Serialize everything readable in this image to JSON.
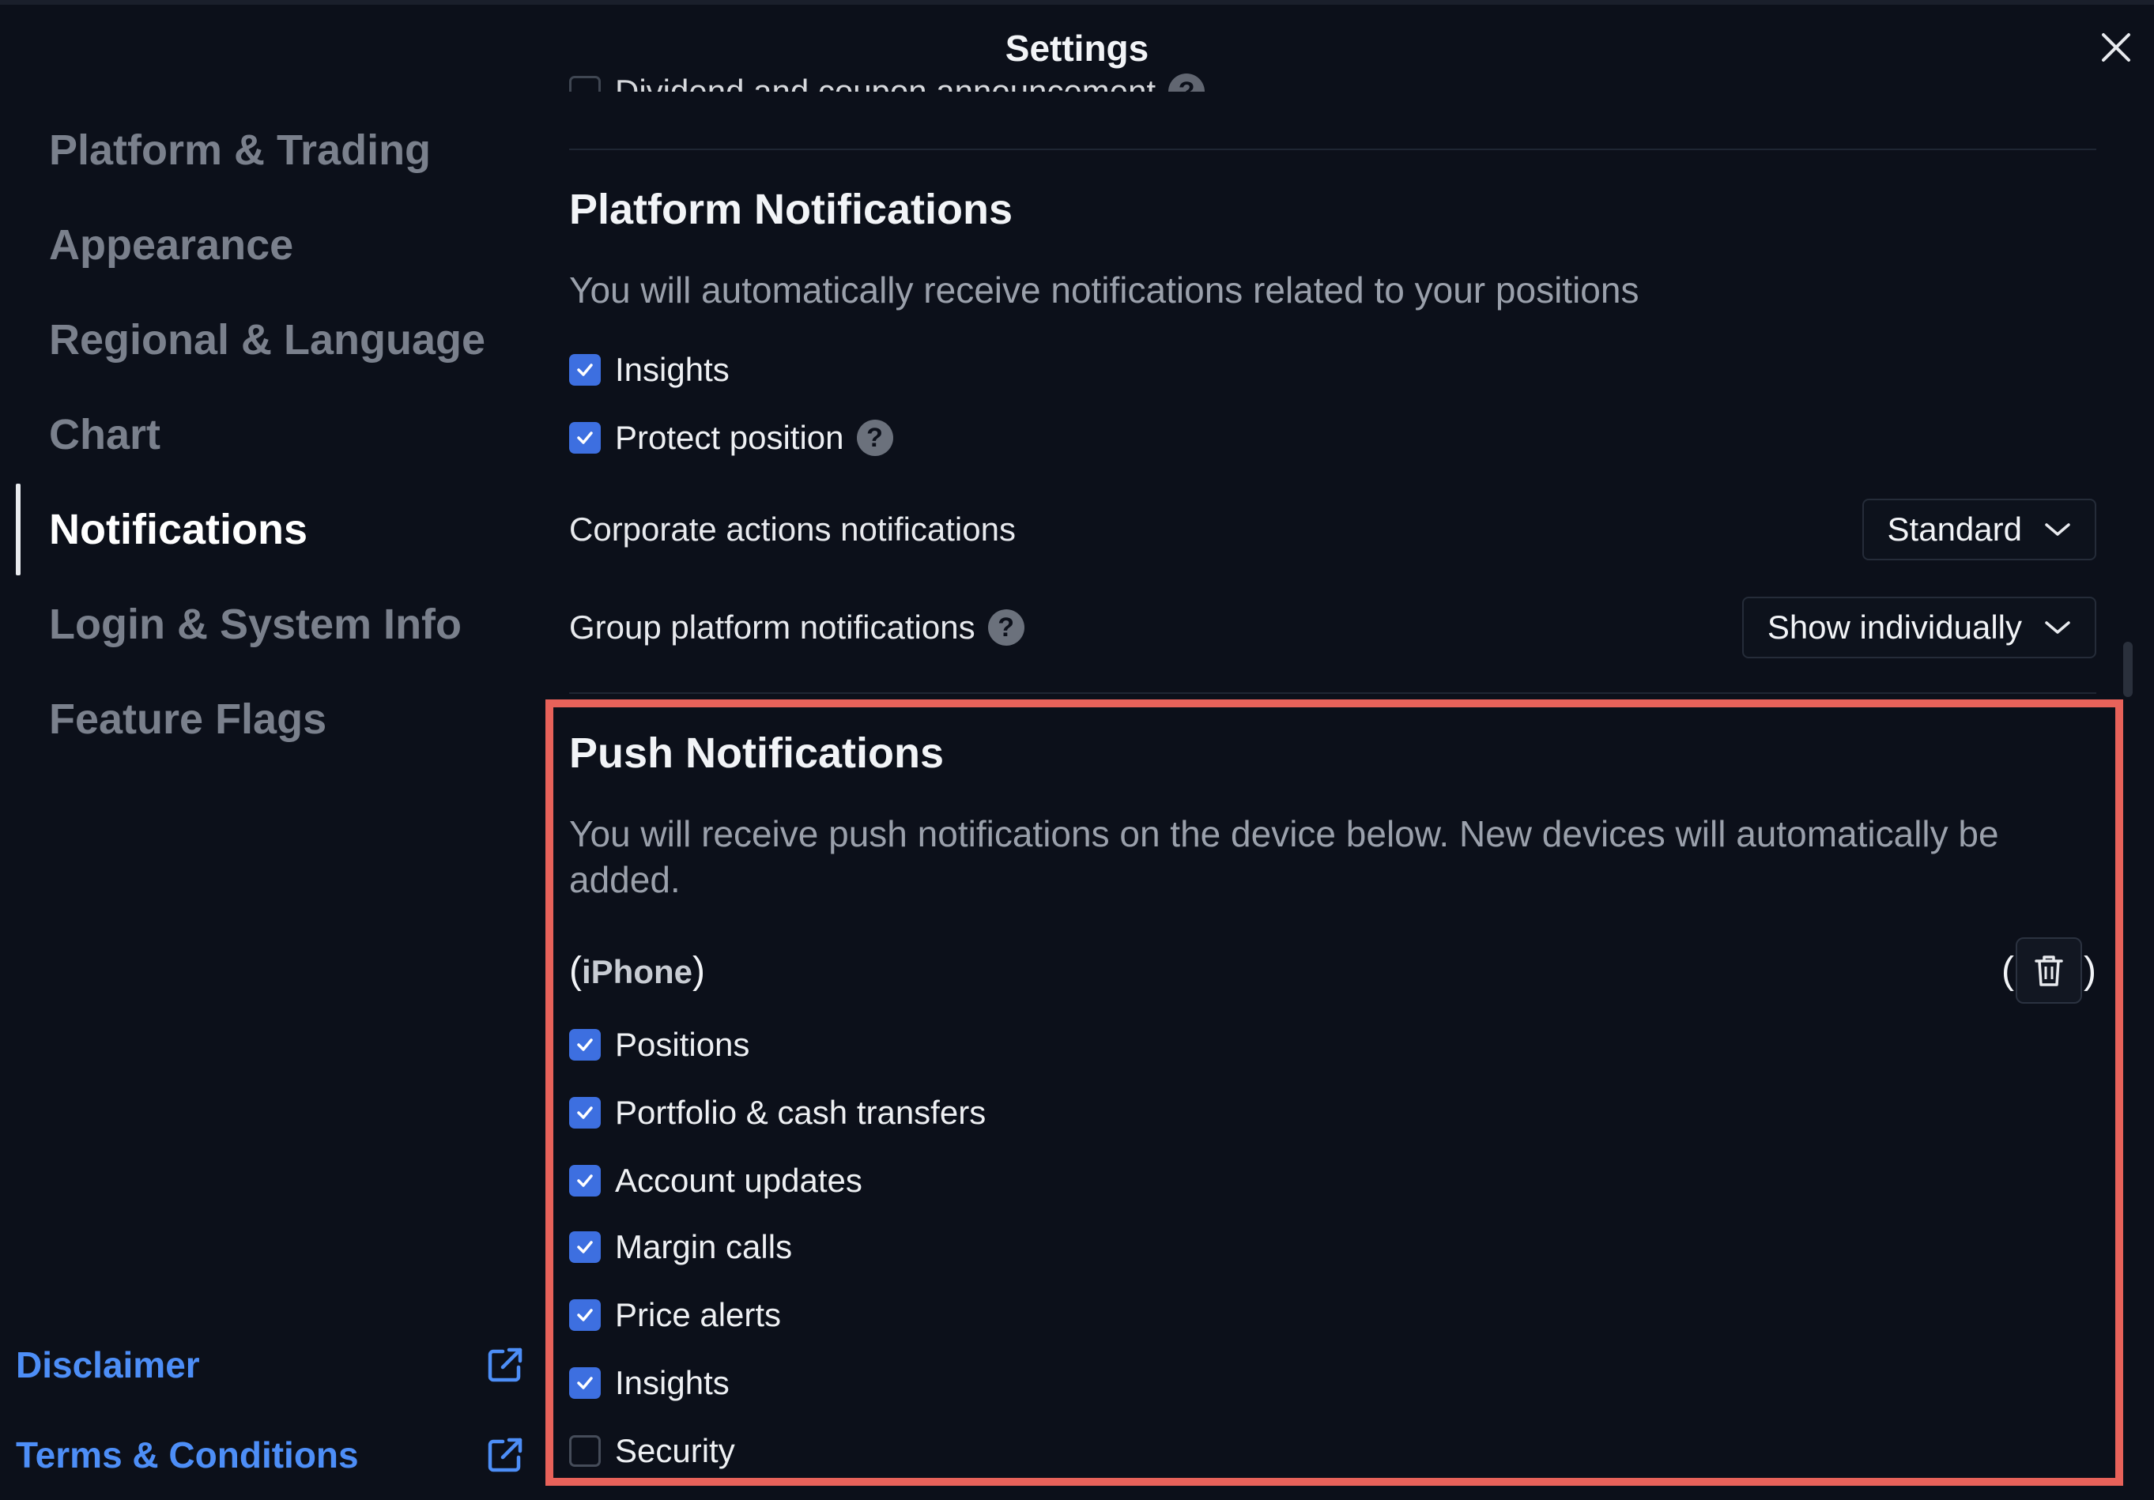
{
  "window": {
    "title": "Settings"
  },
  "sidebar": {
    "items": [
      {
        "label": "Platform & Trading"
      },
      {
        "label": "Appearance"
      },
      {
        "label": "Regional & Language"
      },
      {
        "label": "Chart"
      },
      {
        "label": "Notifications"
      },
      {
        "label": "Login & System Info"
      },
      {
        "label": "Feature Flags"
      }
    ],
    "active": "Notifications",
    "links": [
      {
        "label": "Disclaimer"
      },
      {
        "label": "Terms & Conditions"
      }
    ]
  },
  "main": {
    "cut_off_item": "Dividend and coupon announcement",
    "platform": {
      "title": "Platform Notifications",
      "description": "You will automatically receive notifications related to your positions",
      "checks": [
        {
          "label": "Insights",
          "checked": true
        },
        {
          "label": "Protect position",
          "checked": true
        }
      ],
      "corporate_label": "Corporate actions notifications",
      "corporate_value": "Standard",
      "group_label": "Group platform notifications",
      "group_value": "Show individually"
    },
    "push": {
      "title": "Push Notifications",
      "description": "You will receive push notifications on the device below. New devices will automatically be added.",
      "device_open": "(",
      "device_name": "iPhone",
      "device_close": ")",
      "trash_open": "(",
      "trash_close": ")",
      "checks": [
        {
          "label": "Positions",
          "checked": true
        },
        {
          "label": "Portfolio & cash transfers",
          "checked": true
        },
        {
          "label": "Account updates",
          "checked": true
        },
        {
          "label": "Margin calls",
          "checked": true
        },
        {
          "label": "Price alerts",
          "checked": true
        },
        {
          "label": "Insights",
          "checked": true
        },
        {
          "label": "Security",
          "checked": false
        }
      ]
    }
  },
  "colors": {
    "background": "#0c101a",
    "accent": "#3d6fe0",
    "link": "#4d8ef7",
    "highlight": "#e8625a"
  },
  "icons": {
    "close": "close-icon",
    "external": "external-link-icon",
    "chevron": "chevron-down-icon",
    "help": "help-icon",
    "trash": "trash-icon",
    "check": "check-icon"
  }
}
